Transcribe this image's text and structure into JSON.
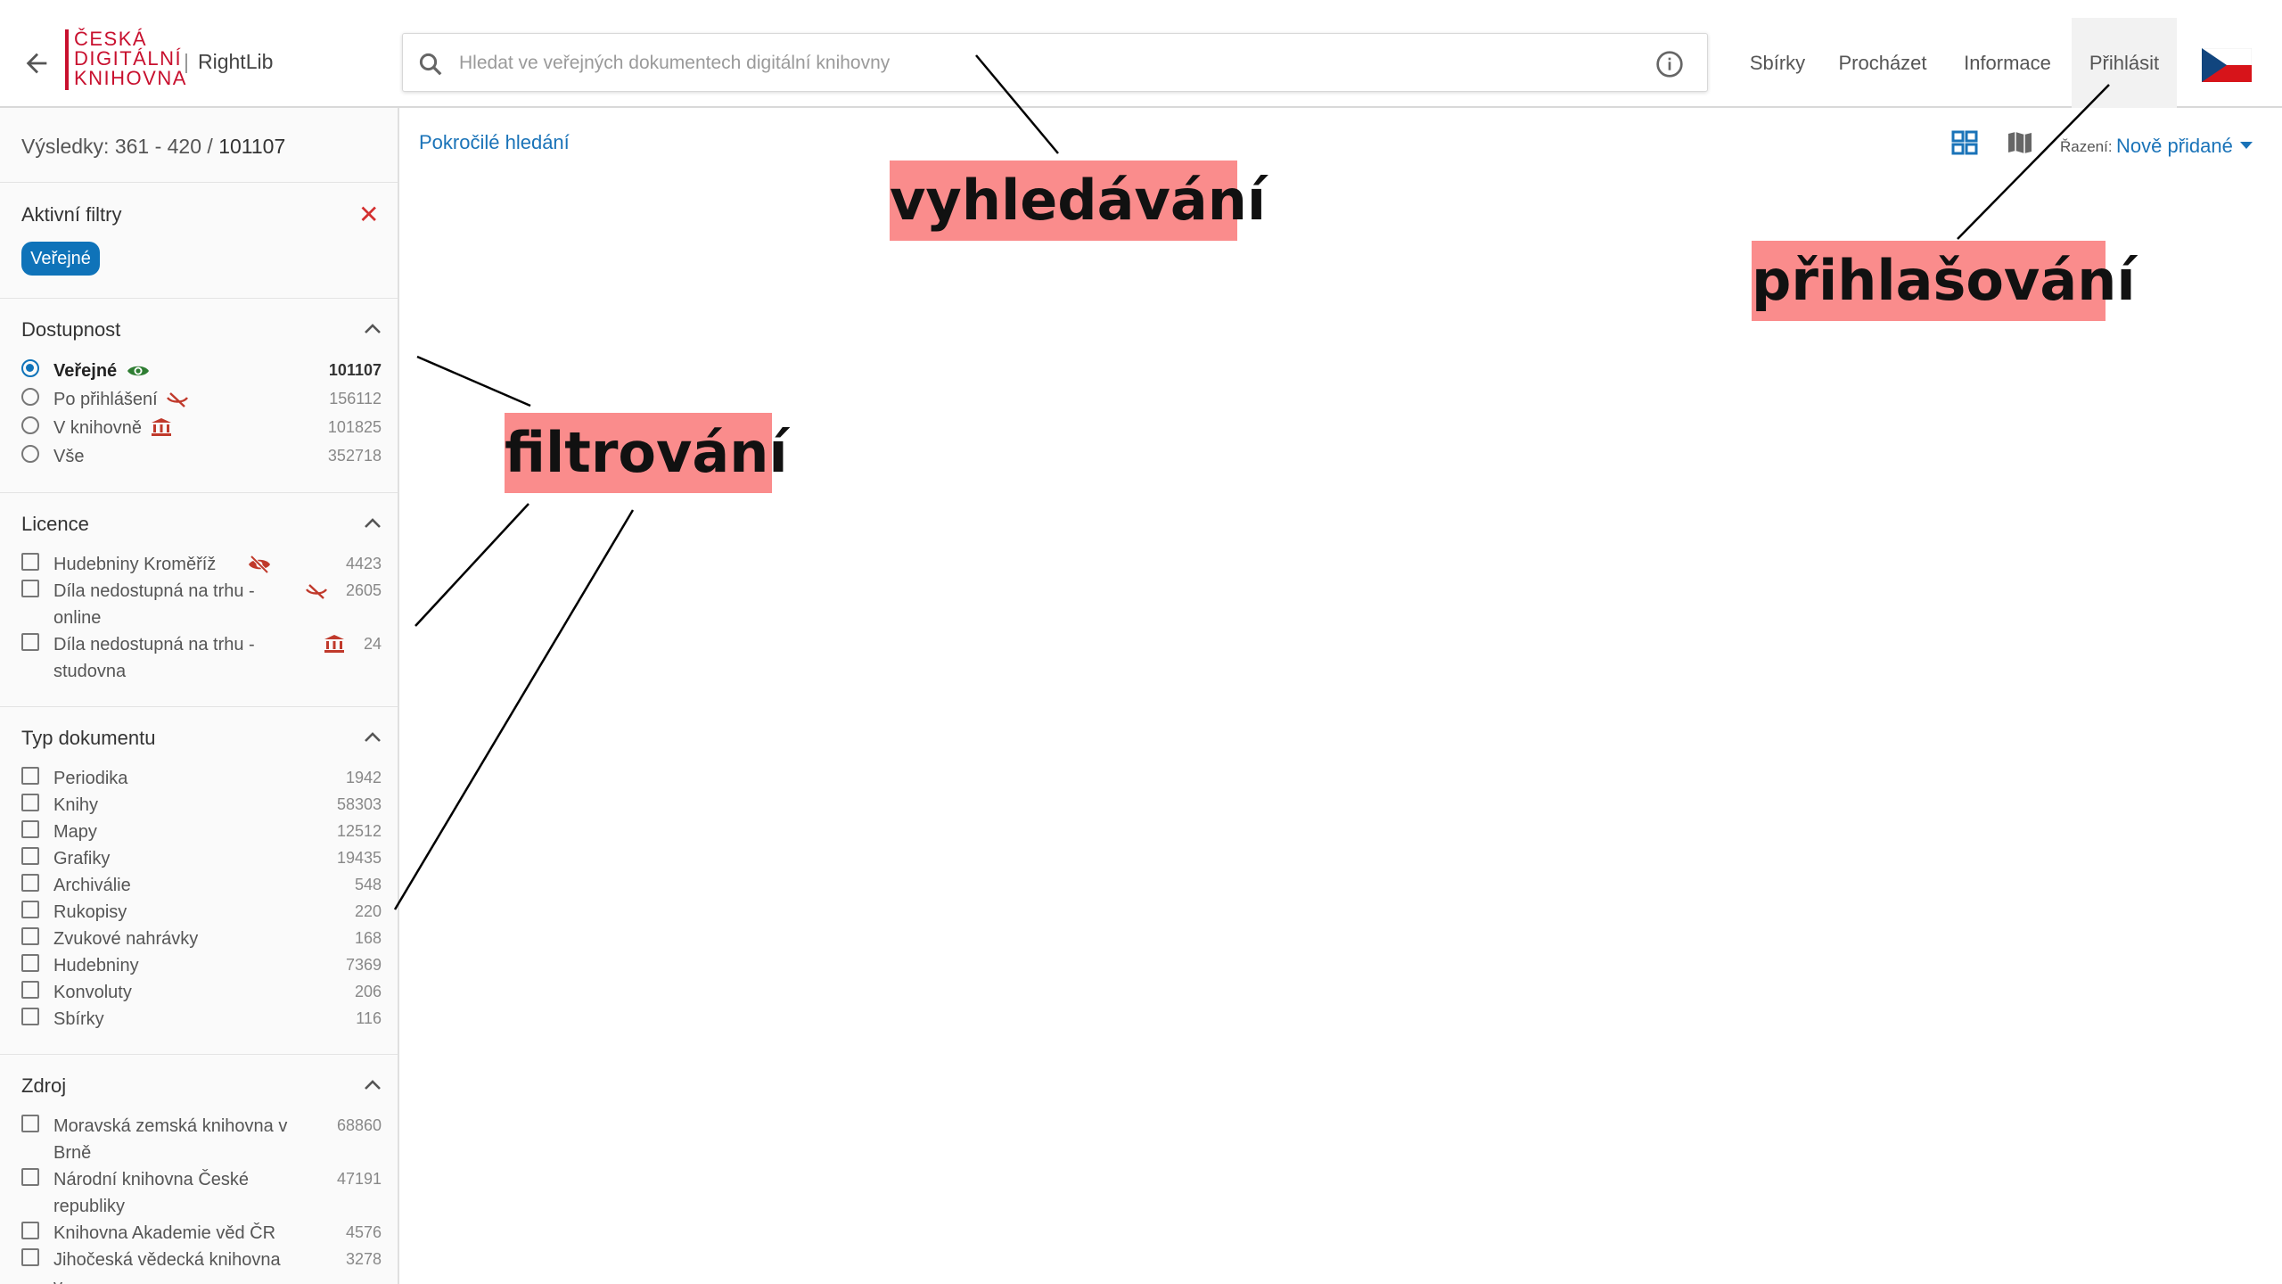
{
  "header": {
    "logo_lines": [
      "ČESKÁ",
      "DIGITÁLNÍ",
      "KNIHOVNA"
    ],
    "app_name": "RightLib",
    "search_placeholder": "Hledat ve veřejných dokumentech digitální knihovny",
    "nav": [
      "Sbírky",
      "Procházet",
      "Informace",
      "Přihlásit"
    ]
  },
  "sidebar": {
    "results_prefix": "Výsledky: 361 - 420 / ",
    "results_total": "101107",
    "active_filters_title": "Aktivní filtry",
    "active_chip": "Veřejné",
    "sections": [
      {
        "title": "Dostupnost",
        "type": "radio",
        "items": [
          {
            "label": "Veřejné",
            "count": "101107",
            "icon": "eye-icon",
            "selected": true
          },
          {
            "label": "Po přihlášení",
            "count": "156112",
            "icon": "eye-off-icon"
          },
          {
            "label": "V knihovně",
            "count": "101825",
            "icon": "library-icon"
          },
          {
            "label": "Vše",
            "count": "352718"
          }
        ]
      },
      {
        "title": "Licence",
        "type": "check",
        "items": [
          {
            "label": "Hudebniny Kroměříž",
            "count": "4423",
            "icon": "eye-slash-icon"
          },
          {
            "label": "Díla nedostupná na trhu - online",
            "count": "2605",
            "icon": "eye-off-icon"
          },
          {
            "label": "Díla nedostupná na trhu - studovna",
            "count": "24",
            "icon": "library-icon"
          }
        ]
      },
      {
        "title": "Typ dokumentu",
        "type": "check",
        "items": [
          {
            "label": "Periodika",
            "count": "1942"
          },
          {
            "label": "Knihy",
            "count": "58303"
          },
          {
            "label": "Mapy",
            "count": "12512"
          },
          {
            "label": "Grafiky",
            "count": "19435"
          },
          {
            "label": "Archiválie",
            "count": "548"
          },
          {
            "label": "Rukopisy",
            "count": "220"
          },
          {
            "label": "Zvukové nahrávky",
            "count": "168"
          },
          {
            "label": "Hudebniny",
            "count": "7369"
          },
          {
            "label": "Konvoluty",
            "count": "206"
          },
          {
            "label": "Sbírky",
            "count": "116"
          }
        ]
      },
      {
        "title": "Zdroj",
        "type": "check",
        "items": [
          {
            "label": "Moravská zemská knihovna v Brně",
            "count": "68860"
          },
          {
            "label": "Národní knihovna České republiky",
            "count": "47191"
          },
          {
            "label": "Knihovna Akademie věd ČR",
            "count": "4576"
          },
          {
            "label": "Jihočeská vědecká knihovna v",
            "count": "3278"
          }
        ]
      }
    ]
  },
  "main": {
    "advanced_search": "Pokročilé hledání",
    "sort_label": "Řazení:",
    "sort_value": "Nově přidané"
  },
  "annotations": {
    "search": "vyhledávání",
    "login": "přihlašování",
    "filter": "filtrování"
  },
  "colors": {
    "accent": "#1a73b8",
    "chip": "#0f73b9",
    "brand_red": "#c8102e",
    "annotation_bg": "#fa8c8c",
    "icon_red": "#c0392b",
    "icon_green": "#2e7d32"
  }
}
